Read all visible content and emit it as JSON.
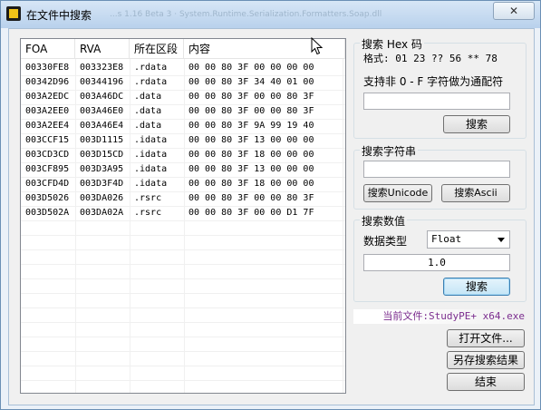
{
  "window": {
    "title": "在文件中搜索",
    "faded_title_text": "...s 1.16 Beta 3  ·  System.Runtime.Serialization.Formatters.Soap.dll",
    "close_glyph": "✕"
  },
  "results": {
    "columns": [
      "FOA",
      "RVA",
      "所在区段",
      "内容"
    ],
    "rows": [
      [
        "00330FE8",
        "003323E8",
        ".rdata",
        "00 00 80 3F 00 00 00 00"
      ],
      [
        "00342D96",
        "00344196",
        ".rdata",
        "00 00 80 3F 34 40 01 00"
      ],
      [
        "003A2EDC",
        "003A46DC",
        ".data",
        "00 00 80 3F 00 00 80 3F"
      ],
      [
        "003A2EE0",
        "003A46E0",
        ".data",
        "00 00 80 3F 00 00 80 3F"
      ],
      [
        "003A2EE4",
        "003A46E4",
        ".data",
        "00 00 80 3F 9A 99 19 40"
      ],
      [
        "003CCF15",
        "003D1115",
        ".idata",
        "00 00 80 3F 13 00 00 00"
      ],
      [
        "003CD3CD",
        "003D15CD",
        ".idata",
        "00 00 80 3F 18 00 00 00"
      ],
      [
        "003CF895",
        "003D3A95",
        ".idata",
        "00 00 80 3F 13 00 00 00"
      ],
      [
        "003CFD4D",
        "003D3F4D",
        ".idata",
        "00 00 80 3F 18 00 00 00"
      ],
      [
        "003D5026",
        "003DA026",
        ".rsrc",
        "00 00 80 3F 00 00 80 3F"
      ],
      [
        "003D502A",
        "003DA02A",
        ".rsrc",
        "00 00 80 3F 00 00 D1 7F"
      ]
    ]
  },
  "hex_search": {
    "title": "搜索 Hex 码",
    "format": "格式: 01 23 ?? 56 ** 78",
    "hint": "支持非 0 - F 字符做为通配符",
    "input_value": "",
    "button": "搜索"
  },
  "string_search": {
    "title": "搜索字符串",
    "input_value": "",
    "unicode_button": "搜索Unicode",
    "ascii_button": "搜索Ascii"
  },
  "value_search": {
    "title": "搜索数值",
    "type_label": "数据类型",
    "type_selected": "Float",
    "value": "1.0",
    "button": "搜索"
  },
  "footer": {
    "current_file": "当前文件:StudyPE+ x64.exe",
    "open_button": "打开文件...",
    "save_button": "另存搜索结果",
    "end_button": "结束"
  },
  "colors": {
    "accent": "#3c7fb1",
    "current_file_text": "#7b2d8e"
  },
  "icons": [
    "app-icon",
    "close-icon",
    "mouse-cursor-icon",
    "chevron-down-icon"
  ]
}
